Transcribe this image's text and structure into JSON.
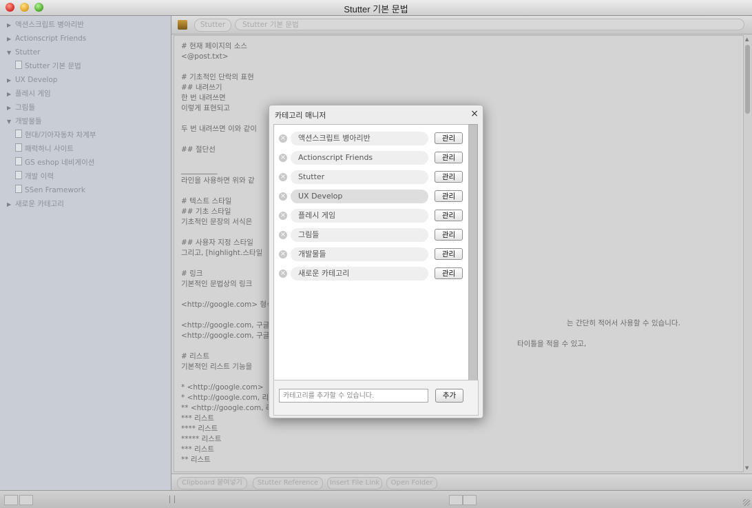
{
  "window": {
    "title": "Stutter 기본 문법"
  },
  "sidebar": {
    "items": [
      {
        "label": "액션스크립트 병아리반",
        "arrow": "▶"
      },
      {
        "label": "Actionscript Friends",
        "arrow": "▶"
      },
      {
        "label": "Stutter",
        "arrow": "▼"
      },
      {
        "label": "Stutter 기본 문법",
        "arrow": ""
      },
      {
        "label": "UX Develop",
        "arrow": "▶"
      },
      {
        "label": "플레시 게임",
        "arrow": "▶"
      },
      {
        "label": "그림들",
        "arrow": "▶"
      },
      {
        "label": "개발물들",
        "arrow": "▼"
      },
      {
        "label": "현대/기아자동차 차계부",
        "arrow": ""
      },
      {
        "label": "패럭하니 사이트",
        "arrow": ""
      },
      {
        "label": "GS eshop 네비게이션",
        "arrow": ""
      },
      {
        "label": "개발 이력",
        "arrow": ""
      },
      {
        "label": "SSen Framework",
        "arrow": ""
      },
      {
        "label": "새로운 카테고리",
        "arrow": "▶"
      }
    ]
  },
  "toolbar": {
    "pill1": "Stutter",
    "pill2": "Stutter 기본 문법"
  },
  "editor": {
    "lines": [
      "# 현재 페이지의 소스",
      "<@post.txt>",
      "",
      "# 기초적인 단락의 표현",
      "## 내려쓰기",
      "한 번 내려쓰면",
      "이렇게 표현되고",
      "",
      "두 번 내려쓰면 이와 같이",
      "",
      "## 절단선",
      "",
      "__________",
      "라인을 사용하면 위와 같",
      "",
      "# 텍스트 스타일",
      "## 기초 스타일",
      "기초적인 문장의 서식은",
      "",
      "## 사용자 지정 스타일",
      "그리고, [highlight.스타일",
      "",
      "# 링크",
      "기본적인 문법상의 링크",
      "",
      "<http://google.com> 형식",
      "",
      "<http://google.com, 구글",
      "<http://google.com, 구글",
      "",
      "# 리스트",
      "기본적인 리스트 기능을",
      "",
      "* <http://google.com>",
      "* <http://google.com, 리",
      "** <http://google.com, 리",
      "*** 리스트",
      "**** 리스트",
      "***** 리스트",
      "*** 리스트",
      "** 리스트"
    ],
    "right_text_1": "는 간단히 적어서 사용할 수 있습니다.",
    "right_text_2": "타이틀을 적을 수 있고,"
  },
  "bottombar": {
    "buttons": [
      "Clipboard 붙여넣기",
      "Stutter Reference",
      "Insert File Link",
      "Open Folder"
    ]
  },
  "dialog": {
    "title": "카테고리 매니저",
    "close": "×",
    "rows": [
      {
        "name": "액션스크립트 병아리반",
        "selected": false
      },
      {
        "name": "Actionscript Friends",
        "selected": false
      },
      {
        "name": "Stutter",
        "selected": false
      },
      {
        "name": "UX Develop",
        "selected": true
      },
      {
        "name": "플레시 게임",
        "selected": false
      },
      {
        "name": "그림들",
        "selected": false
      },
      {
        "name": "개발물들",
        "selected": false
      },
      {
        "name": "새로운 카테고리",
        "selected": false
      }
    ],
    "manage_label": "관리",
    "input_placeholder": "카테고리를 추가할 수 있습니다.",
    "add_label": "추가"
  }
}
